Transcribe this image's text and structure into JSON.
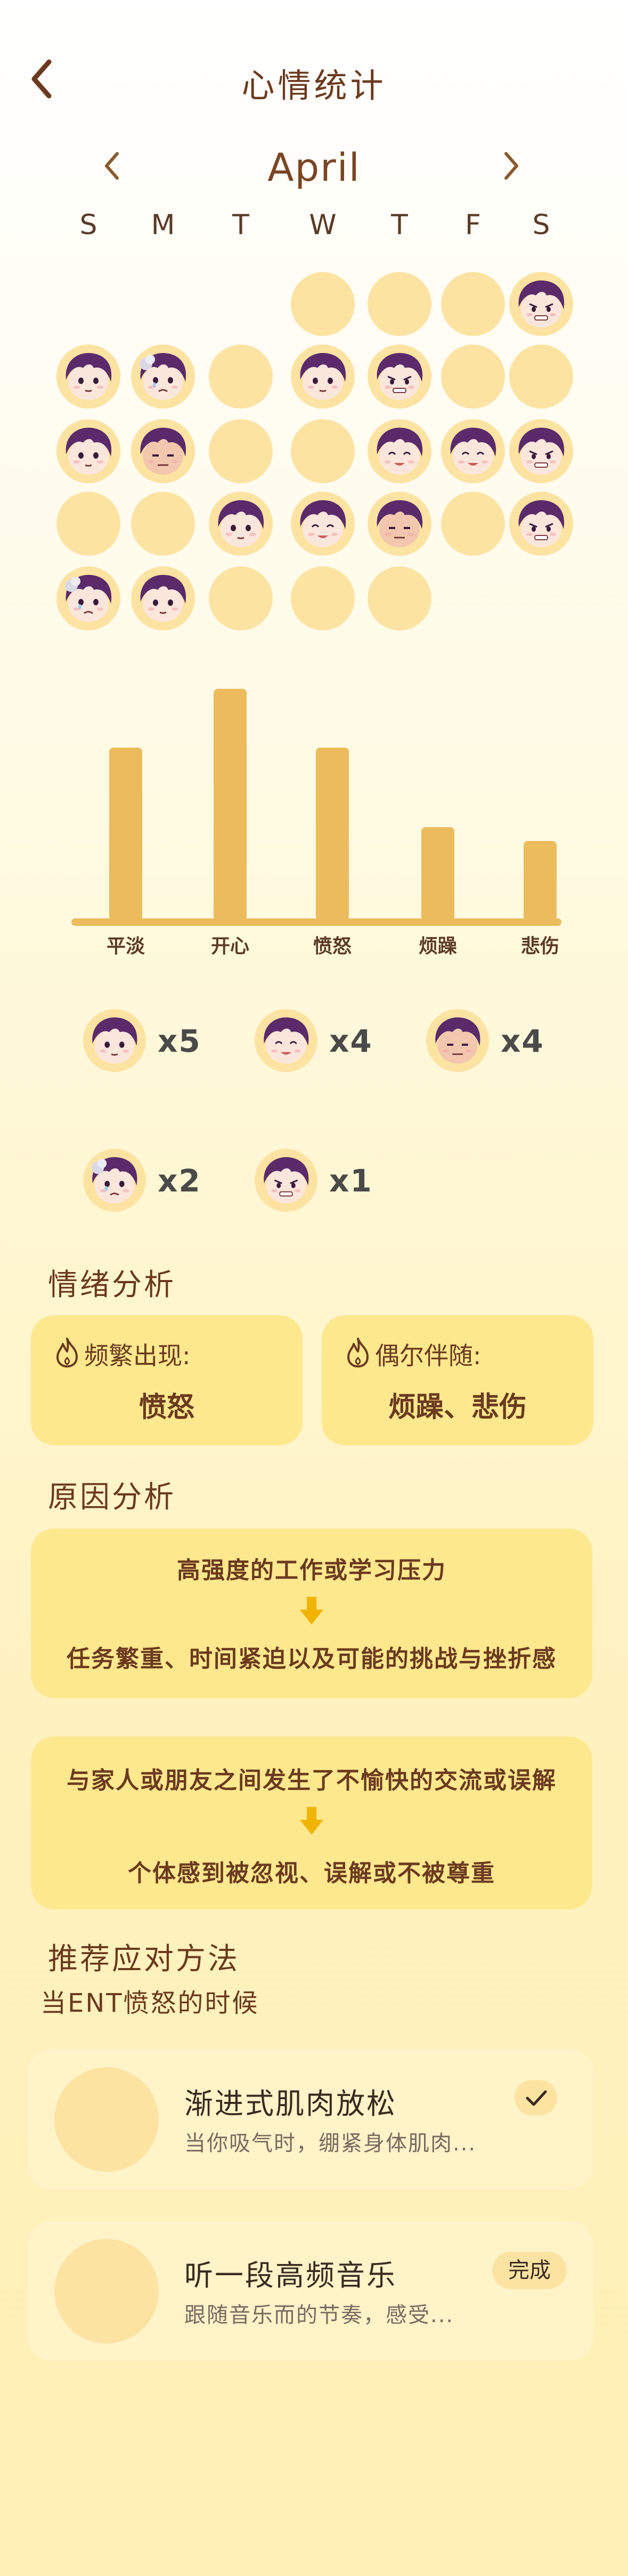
{
  "header": {
    "title": "心情统计"
  },
  "calendar": {
    "month": "April",
    "weekdays": [
      "S",
      "M",
      "T",
      "W",
      "T",
      "F",
      "S"
    ],
    "days": [
      {
        "mood": null
      },
      {
        "mood": null
      },
      {
        "mood": null
      },
      {
        "mood": "none"
      },
      {
        "mood": "none"
      },
      {
        "mood": "none"
      },
      {
        "mood": "angry"
      },
      {
        "mood": "calm"
      },
      {
        "mood": "sad"
      },
      {
        "mood": "none"
      },
      {
        "mood": "calm"
      },
      {
        "mood": "angry"
      },
      {
        "mood": "none"
      },
      {
        "mood": "none"
      },
      {
        "mood": "calm"
      },
      {
        "mood": "annoyed"
      },
      {
        "mood": "none"
      },
      {
        "mood": "none"
      },
      {
        "mood": "happy"
      },
      {
        "mood": "happy"
      },
      {
        "mood": "angry"
      },
      {
        "mood": "none"
      },
      {
        "mood": "none"
      },
      {
        "mood": "calm"
      },
      {
        "mood": "happy"
      },
      {
        "mood": "annoyed"
      },
      {
        "mood": "none"
      },
      {
        "mood": "angry"
      },
      {
        "mood": "sad"
      },
      {
        "mood": "calm"
      },
      {
        "mood": "none"
      },
      {
        "mood": "none"
      },
      {
        "mood": "none"
      },
      {
        "mood": null
      },
      {
        "mood": null
      }
    ]
  },
  "chart_data": {
    "type": "bar",
    "categories": [
      "平淡",
      "开心",
      "愤怒",
      "烦躁",
      "悲伤"
    ],
    "values": [
      5,
      6.7,
      5,
      2.7,
      2.3
    ],
    "color": "#ebbb5c",
    "ylim": [
      0,
      7
    ]
  },
  "mood_counts": [
    {
      "mood": "calm",
      "icon": "calm-face-icon",
      "label": "x5"
    },
    {
      "mood": "happy",
      "icon": "happy-face-icon",
      "label": "x4"
    },
    {
      "mood": "annoyed",
      "icon": "annoyed-face-icon",
      "label": "x4"
    },
    {
      "mood": "sad",
      "icon": "sad-face-icon",
      "label": "x2"
    },
    {
      "mood": "angry",
      "icon": "angry-face-icon",
      "label": "x1"
    }
  ],
  "emotion_analysis": {
    "heading": "情绪分析",
    "frequent_label": "频繁出现:",
    "frequent_value": "愤怒",
    "occasional_label": "偶尔伴随:",
    "occasional_value": "烦躁、悲伤"
  },
  "cause_analysis": {
    "heading": "原因分析",
    "cards": [
      {
        "top": "高强度的工作或学习压力",
        "bottom": "任务繁重、时间紧迫以及可能的挑战与挫折感"
      },
      {
        "top": "与家人或朋友之间发生了不愉快的交流或误解",
        "bottom": "个体感到被忽视、误解或不被尊重"
      }
    ]
  },
  "recommendations": {
    "heading": "推荐应对方法",
    "subheading": "当ENT愤怒的时候",
    "items": [
      {
        "title": "渐进式肌肉放松",
        "desc": "当你吸气时，绷紧身体肌肉...",
        "status": "check"
      },
      {
        "title": "听一段高频音乐",
        "desc": "跟随音乐而的节奏，感受...",
        "status": "完成"
      }
    ]
  },
  "colors": {
    "accent": "#fee88e",
    "bar": "#ebbb5c",
    "empty_day": "#fde3a2",
    "text": "#6b3a1e",
    "arrow": "#f0b400"
  }
}
